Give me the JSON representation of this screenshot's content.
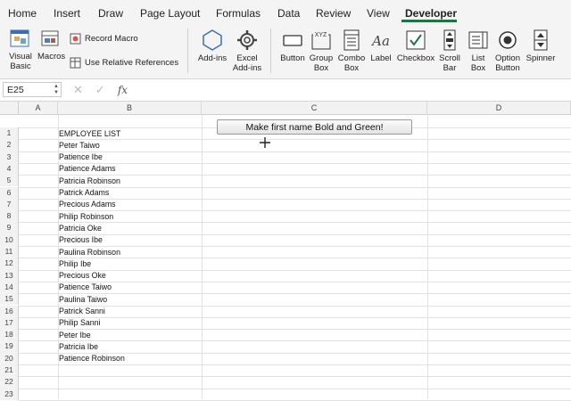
{
  "ribbon_tabs": [
    "Home",
    "Insert",
    "Draw",
    "Page Layout",
    "Formulas",
    "Data",
    "Review",
    "View",
    "Developer"
  ],
  "active_tab": "Developer",
  "ribbon": {
    "visual_basic": "Visual Basic",
    "macros": "Macros",
    "record_macro": "Record Macro",
    "relative_refs": "Use Relative References",
    "addins": "Add-ins",
    "excel_addins": "Excel Add-ins",
    "button": "Button",
    "group_box": "Group Box",
    "combo_box": "Combo Box",
    "label": "Label",
    "checkbox": "Checkbox",
    "scroll_bar": "Scroll Bar",
    "list_box": "List Box",
    "option_button": "Option Button",
    "spinner": "Spinner",
    "group_box_icon_text": "XYZ",
    "label_icon_text": "Aa"
  },
  "formula_bar": {
    "name_box": "E25",
    "fx": "fx",
    "formula": ""
  },
  "columns": [
    "A",
    "B",
    "C",
    "D"
  ],
  "rows": [
    "1",
    "2",
    "3",
    "4",
    "5",
    "6",
    "7",
    "8",
    "9",
    "10",
    "11",
    "12",
    "13",
    "14",
    "15",
    "16",
    "17",
    "18",
    "19",
    "20",
    "21",
    "22",
    "23"
  ],
  "cells_b": [
    "EMPLOYEE LIST",
    "Peter Taiwo",
    "Patience Ibe",
    "Patience Adams",
    "Patricia Robinson",
    "Patrick Adams",
    "Precious Adams",
    "Philip Robinson",
    "Patricia Oke",
    "Precious Ibe",
    "Paulina Robinson",
    "Philip Ibe",
    "Precious Oke",
    "Patience Taiwo",
    "Paulina Taiwo",
    "Patrick Sanni",
    "Philip Sanni",
    "Peter Ibe",
    "Patricia Ibe",
    "Patience Robinson"
  ],
  "macro_button": "Make first name Bold and Green!",
  "colors": {
    "accent": "#1f7244",
    "ribbon_bg": "#f4f4f4"
  }
}
